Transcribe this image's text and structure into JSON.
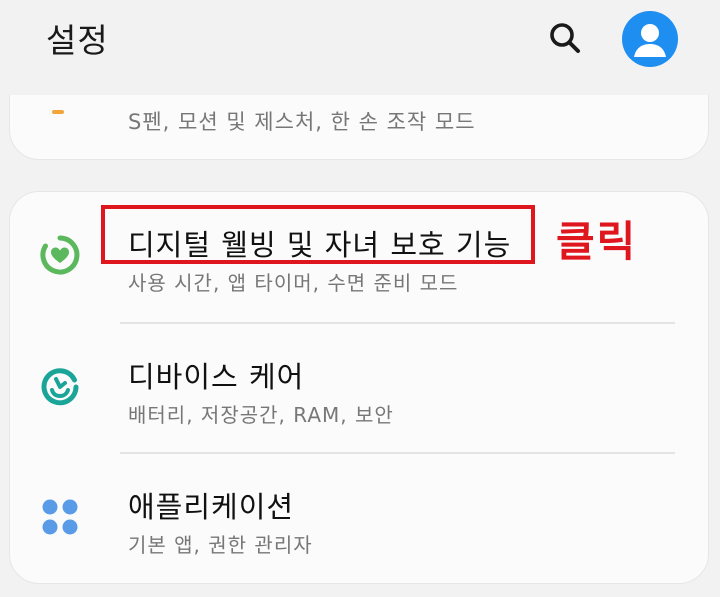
{
  "header": {
    "title": "설정"
  },
  "partial_item": {
    "subtitle": "S펜, 모션 및 제스처, 한 손 조작 모드"
  },
  "items": [
    {
      "title": "디지털 웰빙 및 자녀 보호 기능",
      "subtitle": "사용 시간, 앱 타이머, 수면 준비 모드",
      "icon": "digital-wellbeing-icon"
    },
    {
      "title": "디바이스 케어",
      "subtitle": "배터리, 저장공간, RAM, 보안",
      "icon": "device-care-icon"
    },
    {
      "title": "애플리케이션",
      "subtitle": "기본 앱, 권한 관리자",
      "icon": "apps-icon"
    }
  ],
  "annotation": {
    "label": "클릭"
  },
  "colors": {
    "background": "#f2f2f2",
    "card": "#fbfbfb",
    "avatar": "#1f8ef1",
    "wellbeing": "#5cb85c",
    "device_care": "#1ba598",
    "apps": "#5a9be8",
    "annotation_red": "#e0161f",
    "advanced_orange": "#f3a43a"
  }
}
